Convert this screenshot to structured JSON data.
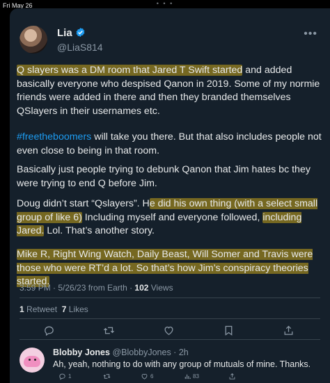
{
  "status_bar": {
    "date": "Fri May 26",
    "dots": "• • •"
  },
  "tweet": {
    "author_name": "Lia",
    "author_handle": "@LiaS814",
    "para1_highlight": "Q slayers was a DM room that Jared T Swift started",
    "para1_rest": " and added basically everyone who despised Qanon in 2019. Some of my normie friends were added in there and then they branded themselves QSlayers in their usernames etc.",
    "para2_hashtag": "#freetheboomers",
    "para2_rest": " will take you there. But that also includes people not even close to being in that room.",
    "para3": "Basically just people trying to debunk Qanon that Jim hates bc they were trying to end Q before Jim.",
    "para4_a": "Doug didn’t start “Qslayers”. H",
    "para4_hl1": "e did his own thing (with a select small group of like 6)",
    "para4_b": " Including myself and everyone followed, ",
    "para4_hl2": "including Jared.",
    "para4_c": " Lol. That’s another story.",
    "para5_highlight": "Mike R, Right Wing Watch, Daily Beast, Will Somer and Travis were those who were RT’d a lot. So that’s how Jim’s conspiracy theories started.",
    "meta_time": "3:59 PM · 5/26/23 from Earth · ",
    "meta_views_count": "102",
    "meta_views_label": " Views",
    "retweets_count": "1",
    "retweets_label": " Retweet  ",
    "likes_count": "7",
    "likes_label": " Likes"
  },
  "reply": {
    "name": "Blobby Jones",
    "handle_time": " @BlobbyJones · 2h",
    "text": "Ah, yeah, nothing to do with any group of mutuals of mine. Thanks.",
    "reply_count": "1",
    "like_count": "6",
    "views_count": "83"
  },
  "colors": {
    "background": "#15202b",
    "accent": "#1d9bf0",
    "highlight": "#b2941c"
  }
}
